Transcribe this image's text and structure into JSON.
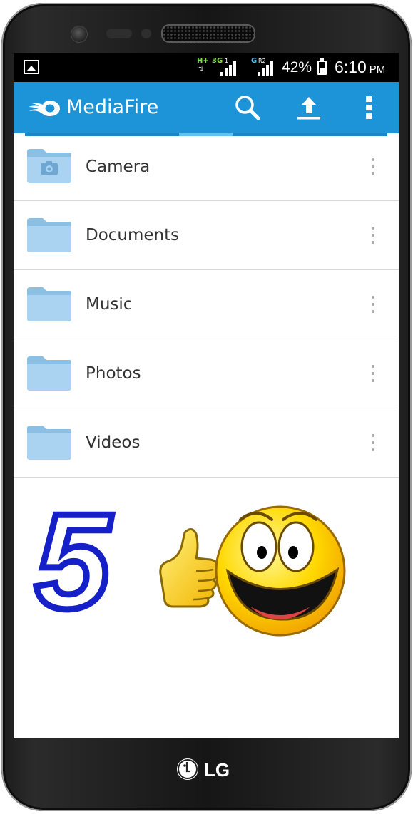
{
  "device": {
    "brand": "LG"
  },
  "statusbar": {
    "network_1": "H+",
    "network_2": "3G",
    "network_3": "G",
    "sim_1": "1",
    "sim_2": "R2",
    "battery_percent": "42%",
    "battery_level": 0.42,
    "time": "6:10",
    "ampm": "PM"
  },
  "actionbar": {
    "title": "MediaFire",
    "accent_color": "#1e94d8",
    "icons": [
      "mediafire-logo-icon",
      "search-icon",
      "upload-icon",
      "overflow-menu-icon"
    ]
  },
  "folders": [
    {
      "label": "Camera",
      "icon": "camera-folder-icon"
    },
    {
      "label": "Documents",
      "icon": "folder-icon"
    },
    {
      "label": "Music",
      "icon": "folder-icon"
    },
    {
      "label": "Photos",
      "icon": "folder-icon"
    },
    {
      "label": "Videos",
      "icon": "folder-icon"
    }
  ],
  "overlay": {
    "rating": "5",
    "rating_color": "#1520c8",
    "icons": [
      "thumbs-up-icon",
      "smiley-icon"
    ]
  }
}
